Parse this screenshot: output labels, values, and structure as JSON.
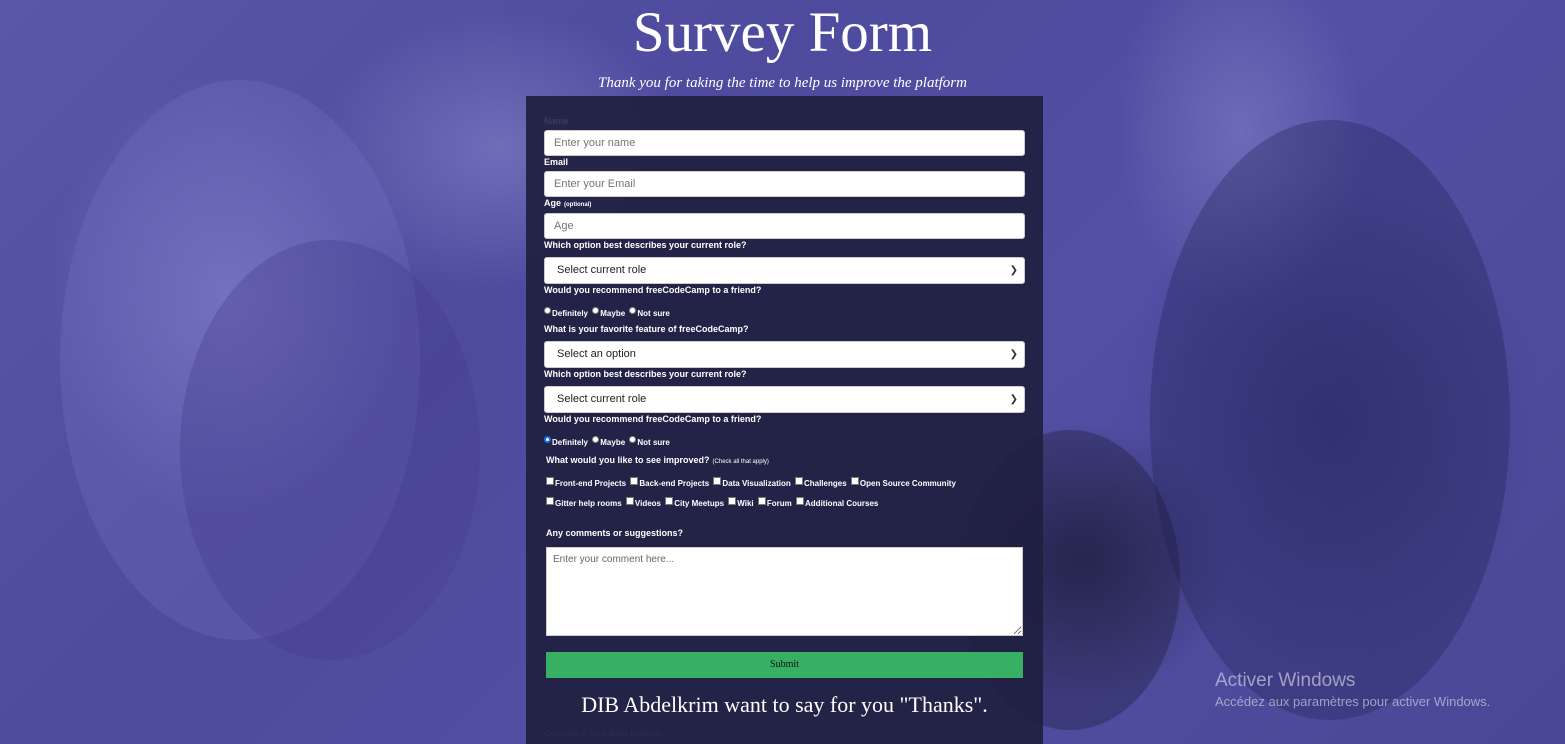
{
  "header": {
    "title": "Survey Form",
    "description": "Thank you for taking the time to help us improve the platform"
  },
  "form": {
    "name": {
      "label": "Name",
      "placeholder": "Enter your name"
    },
    "email": {
      "label": "Email",
      "placeholder": "Enter your Email"
    },
    "age": {
      "label": "Age",
      "note": "(optional)",
      "placeholder": "Age"
    },
    "role1": {
      "label": "Which option best describes your current role?",
      "selected": "Select current role"
    },
    "recommend1": {
      "label": "Would you recommend freeCodeCamp to a friend?",
      "options": [
        "Definitely",
        "Maybe",
        "Not sure"
      ],
      "checked_index": -1
    },
    "feature": {
      "label": "What is your favorite feature of freeCodeCamp?",
      "selected": "Select an option"
    },
    "role2": {
      "label": "Which option best describes your current role?",
      "selected": "Select current role"
    },
    "recommend2": {
      "label": "Would you recommend freeCodeCamp to a friend?",
      "options": [
        "Definitely",
        "Maybe",
        "Not sure"
      ],
      "checked_index": 0
    },
    "improve": {
      "label": "What would you like to see improved?",
      "note": "(Check all that apply)",
      "row1": [
        "Front-end Projects",
        "Back-end Projects",
        "Data Visualization",
        "Challenges",
        "Open Source Community"
      ],
      "row2": [
        "Gitter help rooms",
        "Videos",
        "City Meetups",
        "Wiki",
        "Forum",
        "Additional Courses"
      ]
    },
    "comments": {
      "label": "Any comments or suggestions?",
      "placeholder": "Enter your comment here..."
    },
    "submit_label": "Submit",
    "thanks": "DIB Abdelkrim want to say for you \"Thanks\".",
    "copyright": "Copyright © Tous droits réservés"
  },
  "watermark": {
    "title": "Activer Windows",
    "subtitle": "Accédez aux paramètres pour activer Windows."
  }
}
